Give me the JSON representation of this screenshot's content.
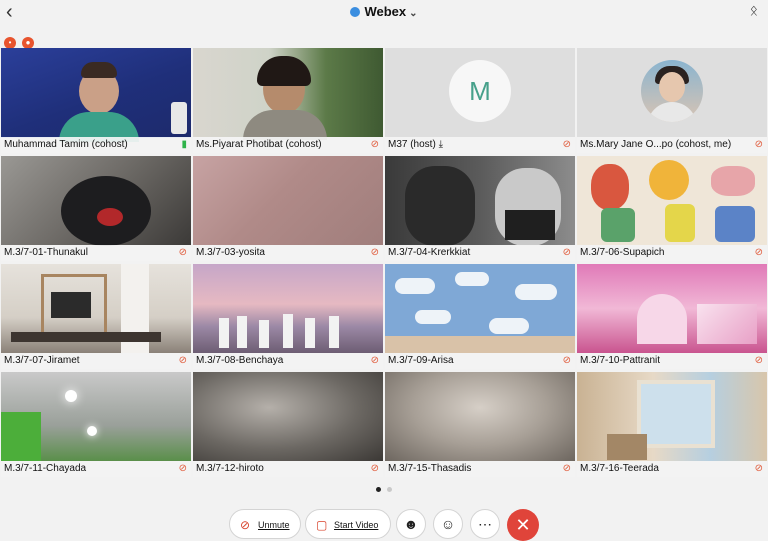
{
  "app": {
    "title": "Webex"
  },
  "icons": {
    "back": "chevron-left-icon",
    "bluetooth": "bluetooth-icon",
    "shield": "shield-icon",
    "mic_muted": "muted-mic-icon",
    "mic_on": "mic-icon",
    "share": "share-screen-icon"
  },
  "colors": {
    "end_call": "#e0443a",
    "muted": "#e05a3a",
    "avatar_letter": "#46a08a",
    "accent": "#3b8ee0"
  },
  "participants": [
    {
      "name": "Muhammad Tamim (cohost)",
      "mic": "on"
    },
    {
      "name": "Ms.Piyarat Photibat (cohost)",
      "mic": "muted"
    },
    {
      "name": "M37 (host)",
      "mic": "muted",
      "initial": "M"
    },
    {
      "name": "Ms.Mary Jane O...po (cohost, me)",
      "mic": "muted"
    },
    {
      "name": "M.3/7-01-Thunakul",
      "mic": "muted"
    },
    {
      "name": "M.3/7-03-yosita",
      "mic": "muted"
    },
    {
      "name": "M.3/7-04-Krerkkiat",
      "mic": "muted"
    },
    {
      "name": "M.3/7-06-Supapich",
      "mic": "muted"
    },
    {
      "name": "M.3/7-07-Jiramet",
      "mic": "muted"
    },
    {
      "name": "M.3/7-08-Benchaya",
      "mic": "muted"
    },
    {
      "name": "M.3/7-09-Arisa",
      "mic": "muted"
    },
    {
      "name": "M.3/7-10-Pattranit",
      "mic": "muted"
    },
    {
      "name": "M.3/7-11-Chayada",
      "mic": "muted"
    },
    {
      "name": "M.3/7-12-hiroto",
      "mic": "muted"
    },
    {
      "name": "M.3/7-15-Thasadis",
      "mic": "muted"
    },
    {
      "name": "M.3/7-16-Teerada",
      "mic": "muted"
    }
  ],
  "pager": {
    "pages": 2,
    "current": 1
  },
  "controls": {
    "unmute_label": "Unmute",
    "start_video_label": "Start Video",
    "participants_icon": "person-icon",
    "reactions_icon": "emoji-icon",
    "more_icon": "more-icon",
    "end_icon": "close-icon"
  }
}
